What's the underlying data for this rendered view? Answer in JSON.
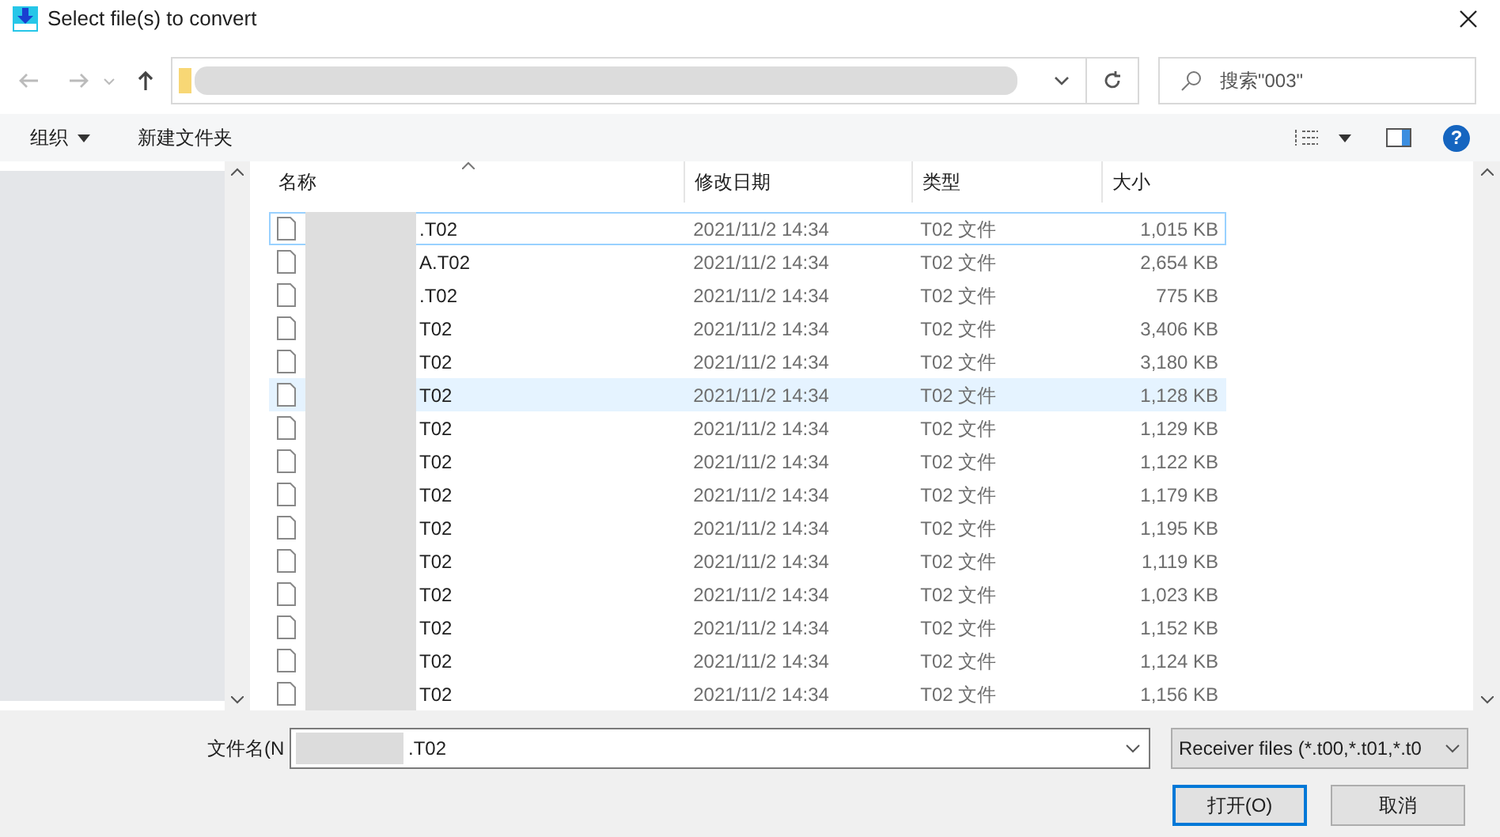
{
  "window": {
    "title": "Select file(s) to convert"
  },
  "help": {
    "glyph": "?"
  },
  "search": {
    "placeholder": "搜索\"003\""
  },
  "toolbar": {
    "organize": "组织",
    "new_folder": "新建文件夹"
  },
  "table": {
    "columns": [
      {
        "label": "名称",
        "sorted": true
      },
      {
        "label": "修改日期",
        "sorted": false
      },
      {
        "label": "类型",
        "sorted": false
      },
      {
        "label": "大小",
        "sorted": false
      }
    ],
    "rows": [
      {
        "name": ".T02",
        "date": "2021/11/2 14:34",
        "type": "T02 文件",
        "size": "1,015 KB",
        "selected": false,
        "focused": true
      },
      {
        "name": "A.T02",
        "date": "2021/11/2 14:34",
        "type": "T02 文件",
        "size": "2,654 KB",
        "selected": false,
        "focused": false
      },
      {
        "name": ".T02",
        "date": "2021/11/2 14:34",
        "type": "T02 文件",
        "size": "775 KB",
        "selected": false,
        "focused": false
      },
      {
        "name": "T02",
        "date": "2021/11/2 14:34",
        "type": "T02 文件",
        "size": "3,406 KB",
        "selected": false,
        "focused": false
      },
      {
        "name": "T02",
        "date": "2021/11/2 14:34",
        "type": "T02 文件",
        "size": "3,180 KB",
        "selected": false,
        "focused": false
      },
      {
        "name": "T02",
        "date": "2021/11/2 14:34",
        "type": "T02 文件",
        "size": "1,128 KB",
        "selected": true,
        "focused": false
      },
      {
        "name": "T02",
        "date": "2021/11/2 14:34",
        "type": "T02 文件",
        "size": "1,129 KB",
        "selected": false,
        "focused": false
      },
      {
        "name": "T02",
        "date": "2021/11/2 14:34",
        "type": "T02 文件",
        "size": "1,122 KB",
        "selected": false,
        "focused": false
      },
      {
        "name": "T02",
        "date": "2021/11/2 14:34",
        "type": "T02 文件",
        "size": "1,179 KB",
        "selected": false,
        "focused": false
      },
      {
        "name": "T02",
        "date": "2021/11/2 14:34",
        "type": "T02 文件",
        "size": "1,195 KB",
        "selected": false,
        "focused": false
      },
      {
        "name": "T02",
        "date": "2021/11/2 14:34",
        "type": "T02 文件",
        "size": "1,119 KB",
        "selected": false,
        "focused": false
      },
      {
        "name": "T02",
        "date": "2021/11/2 14:34",
        "type": "T02 文件",
        "size": "1,023 KB",
        "selected": false,
        "focused": false
      },
      {
        "name": "T02",
        "date": "2021/11/2 14:34",
        "type": "T02 文件",
        "size": "1,152 KB",
        "selected": false,
        "focused": false
      },
      {
        "name": "T02",
        "date": "2021/11/2 14:34",
        "type": "T02 文件",
        "size": "1,124 KB",
        "selected": false,
        "focused": false
      },
      {
        "name": "T02",
        "date": "2021/11/2 14:34",
        "type": "T02 文件",
        "size": "1,156 KB",
        "selected": false,
        "focused": false
      }
    ]
  },
  "filename": {
    "label": "文件名(N",
    "value": ".T02"
  },
  "filter": {
    "value": "Receiver files (*.t00,*.t01,*.t0"
  },
  "buttons": [
    {
      "label": "打开(O)",
      "primary": true
    },
    {
      "label": "取消",
      "primary": false
    }
  ]
}
